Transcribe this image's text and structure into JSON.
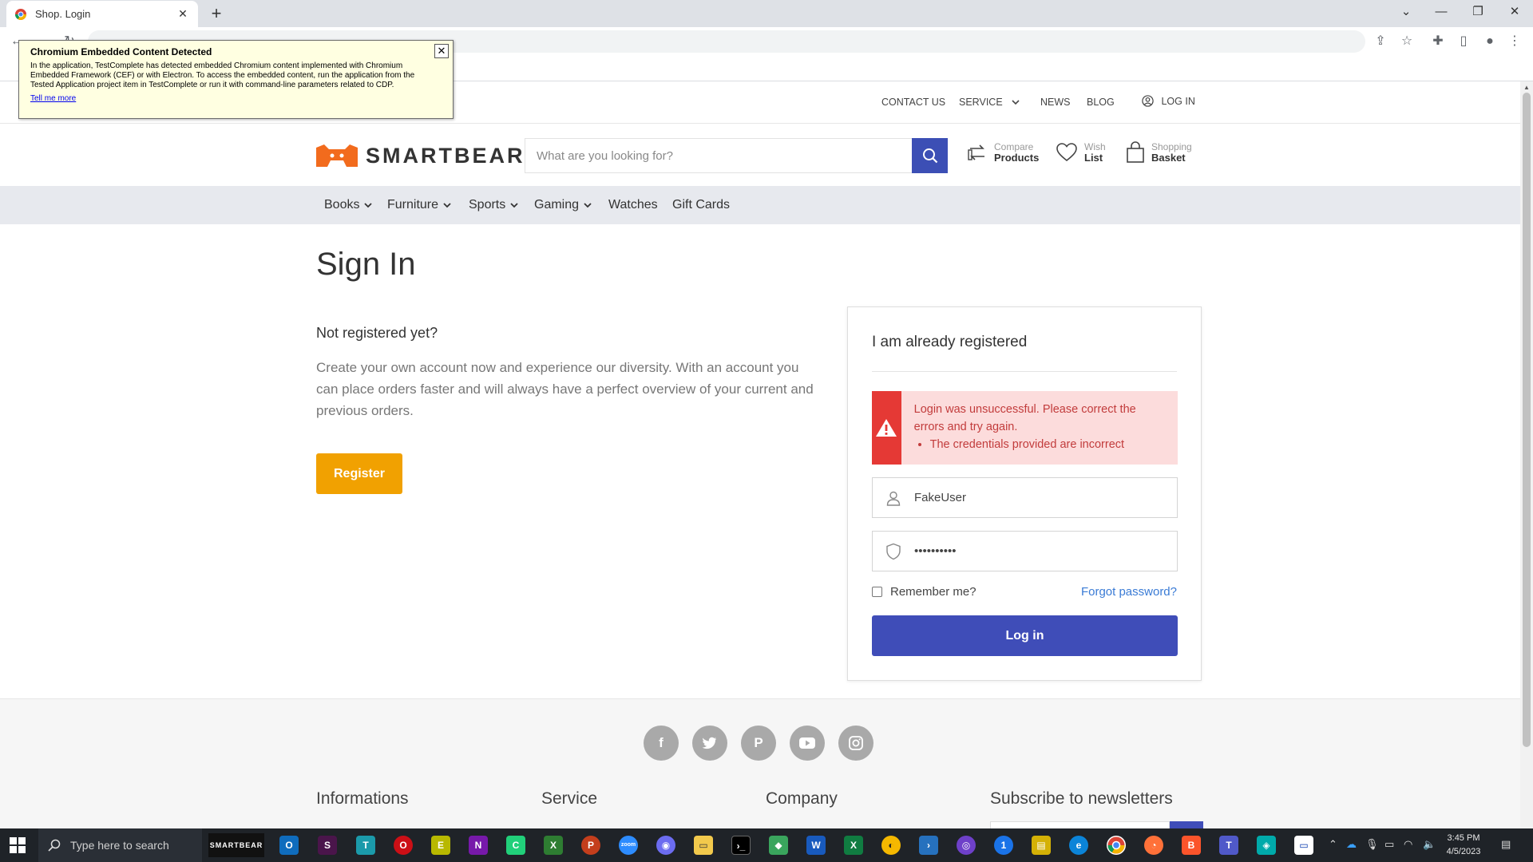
{
  "browser": {
    "tab_title": "Shop. Login",
    "new_tab_symbol": "+",
    "close_symbol": "✕"
  },
  "cef_notice": {
    "title": "Chromium Embedded Content Detected",
    "body": "In the application, TestComplete has detected embedded Chromium content implemented with Chromium Embedded Framework (CEF) or with Electron. To access the embedded content, run the application from the Tested Application project item in TestComplete or run it with command-line parameters related to CDP.",
    "link": "Tell me more",
    "close_symbol": "✕"
  },
  "topnav": {
    "contact": "CONTACT US",
    "service": "SERVICE",
    "news": "NEWS",
    "blog": "BLOG",
    "login": "LOG IN"
  },
  "header": {
    "logo_text": "SMARTBEAR",
    "search_placeholder": "What are you looking for?",
    "compare_small": "Compare",
    "compare_big": "Products",
    "wish_small": "Wish",
    "wish_big": "List",
    "basket_small": "Shopping",
    "basket_big": "Basket"
  },
  "categories": [
    {
      "label": "Books",
      "chevron": true
    },
    {
      "label": "Furniture",
      "chevron": true
    },
    {
      "label": "Sports",
      "chevron": true
    },
    {
      "label": "Gaming",
      "chevron": true
    },
    {
      "label": "Watches",
      "chevron": false
    },
    {
      "label": "Gift Cards",
      "chevron": false
    }
  ],
  "signin": {
    "title": "Sign In",
    "not_registered": "Not registered yet?",
    "description": "Create your own account now and experience our diversity. With an account you can place orders faster and will always have a perfect overview of your current and previous orders.",
    "register_label": "Register"
  },
  "login_card": {
    "title": "I am already registered",
    "error_message": "Login was unsuccessful. Please correct the errors and try again.",
    "error_detail": "The credentials provided are incorrect",
    "username_value": "FakeUser",
    "password_value": "••••••••••",
    "remember_label": "Remember me?",
    "forgot_label": "Forgot password?",
    "login_label": "Log in"
  },
  "footer": {
    "social": [
      "facebook-icon",
      "twitter-icon",
      "pinterest-icon",
      "youtube-icon",
      "instagram-icon"
    ],
    "col1": "Informations",
    "col2": "Service",
    "col3": "Company",
    "col4": "Subscribe to newsletters"
  },
  "taskbar": {
    "search_placeholder": "Type here to search",
    "smartbear_label": "SMARTBEAR",
    "time": "3:45 PM",
    "date": "4/5/2023"
  },
  "colors": {
    "brand_orange": "#f1a101",
    "primary_blue": "#3f4db8",
    "error_red": "#e53935",
    "error_bg": "#fcdcdc"
  }
}
